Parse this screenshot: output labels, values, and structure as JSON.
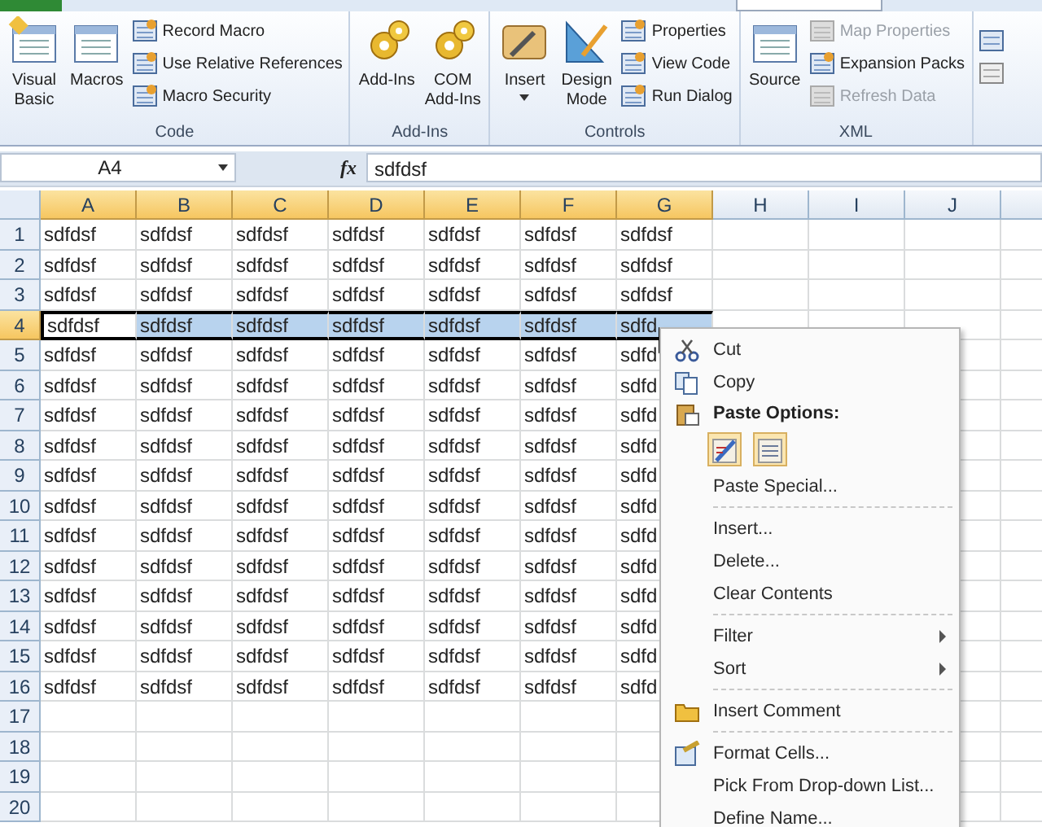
{
  "ribbon": {
    "groups": [
      {
        "label": "Code",
        "large": [
          {
            "lines": [
              "Visual",
              "Basic"
            ]
          },
          {
            "lines": [
              "Macros"
            ]
          }
        ],
        "small": [
          {
            "label": "Record Macro",
            "disabled": false
          },
          {
            "label": "Use Relative References",
            "disabled": false
          },
          {
            "label": "Macro Security",
            "disabled": false
          }
        ]
      },
      {
        "label": "Add-Ins",
        "large": [
          {
            "lines": [
              "Add-Ins"
            ]
          },
          {
            "lines": [
              "COM",
              "Add-Ins"
            ]
          }
        ]
      },
      {
        "label": "Controls",
        "large": [
          {
            "lines": [
              "Insert"
            ],
            "dropdown": true
          },
          {
            "lines": [
              "Design",
              "Mode"
            ]
          }
        ],
        "small": [
          {
            "label": "Properties",
            "disabled": false
          },
          {
            "label": "View Code",
            "disabled": false
          },
          {
            "label": "Run Dialog",
            "disabled": false
          }
        ]
      },
      {
        "label": "XML",
        "large": [
          {
            "lines": [
              "Source"
            ]
          }
        ],
        "small": [
          {
            "label": "Map Properties",
            "disabled": true
          },
          {
            "label": "Expansion Packs",
            "disabled": false
          },
          {
            "label": "Refresh Data",
            "disabled": true
          }
        ]
      }
    ]
  },
  "formula_bar": {
    "name_box": "A4",
    "fx": "fx",
    "value": "sdfdsf"
  },
  "sheet": {
    "columns": [
      {
        "label": "A",
        "selected": true
      },
      {
        "label": "B",
        "selected": true
      },
      {
        "label": "C",
        "selected": true
      },
      {
        "label": "D",
        "selected": true
      },
      {
        "label": "E",
        "selected": true
      },
      {
        "label": "F",
        "selected": true
      },
      {
        "label": "G",
        "selected": true
      },
      {
        "label": "H",
        "selected": false
      },
      {
        "label": "I",
        "selected": false
      },
      {
        "label": "J",
        "selected": false
      }
    ],
    "rows": [
      {
        "number": "1",
        "selected": false,
        "cells": [
          "sdfdsf",
          "sdfdsf",
          "sdfdsf",
          "sdfdsf",
          "sdfdsf",
          "sdfdsf",
          "sdfdsf"
        ]
      },
      {
        "number": "2",
        "selected": false,
        "cells": [
          "sdfdsf",
          "sdfdsf",
          "sdfdsf",
          "sdfdsf",
          "sdfdsf",
          "sdfdsf",
          "sdfdsf"
        ]
      },
      {
        "number": "3",
        "selected": false,
        "cells": [
          "sdfdsf",
          "sdfdsf",
          "sdfdsf",
          "sdfdsf",
          "sdfdsf",
          "sdfdsf",
          "sdfdsf"
        ]
      },
      {
        "number": "4",
        "selected": true,
        "cells": [
          "sdfdsf",
          "sdfdsf",
          "sdfdsf",
          "sdfdsf",
          "sdfdsf",
          "sdfdsf",
          "sdfd"
        ]
      },
      {
        "number": "5",
        "selected": false,
        "cells": [
          "sdfdsf",
          "sdfdsf",
          "sdfdsf",
          "sdfdsf",
          "sdfdsf",
          "sdfdsf",
          "sdfd"
        ]
      },
      {
        "number": "6",
        "selected": false,
        "cells": [
          "sdfdsf",
          "sdfdsf",
          "sdfdsf",
          "sdfdsf",
          "sdfdsf",
          "sdfdsf",
          "sdfd"
        ]
      },
      {
        "number": "7",
        "selected": false,
        "cells": [
          "sdfdsf",
          "sdfdsf",
          "sdfdsf",
          "sdfdsf",
          "sdfdsf",
          "sdfdsf",
          "sdfd"
        ]
      },
      {
        "number": "8",
        "selected": false,
        "cells": [
          "sdfdsf",
          "sdfdsf",
          "sdfdsf",
          "sdfdsf",
          "sdfdsf",
          "sdfdsf",
          "sdfd"
        ]
      },
      {
        "number": "9",
        "selected": false,
        "cells": [
          "sdfdsf",
          "sdfdsf",
          "sdfdsf",
          "sdfdsf",
          "sdfdsf",
          "sdfdsf",
          "sdfd"
        ]
      },
      {
        "number": "10",
        "selected": false,
        "cells": [
          "sdfdsf",
          "sdfdsf",
          "sdfdsf",
          "sdfdsf",
          "sdfdsf",
          "sdfdsf",
          "sdfd"
        ]
      },
      {
        "number": "11",
        "selected": false,
        "cells": [
          "sdfdsf",
          "sdfdsf",
          "sdfdsf",
          "sdfdsf",
          "sdfdsf",
          "sdfdsf",
          "sdfd"
        ]
      },
      {
        "number": "12",
        "selected": false,
        "cells": [
          "sdfdsf",
          "sdfdsf",
          "sdfdsf",
          "sdfdsf",
          "sdfdsf",
          "sdfdsf",
          "sdfd"
        ]
      },
      {
        "number": "13",
        "selected": false,
        "cells": [
          "sdfdsf",
          "sdfdsf",
          "sdfdsf",
          "sdfdsf",
          "sdfdsf",
          "sdfdsf",
          "sdfd"
        ]
      },
      {
        "number": "14",
        "selected": false,
        "cells": [
          "sdfdsf",
          "sdfdsf",
          "sdfdsf",
          "sdfdsf",
          "sdfdsf",
          "sdfdsf",
          "sdfd"
        ]
      },
      {
        "number": "15",
        "selected": false,
        "cells": [
          "sdfdsf",
          "sdfdsf",
          "sdfdsf",
          "sdfdsf",
          "sdfdsf",
          "sdfdsf",
          "sdfd"
        ]
      },
      {
        "number": "16",
        "selected": false,
        "cells": [
          "sdfdsf",
          "sdfdsf",
          "sdfdsf",
          "sdfdsf",
          "sdfdsf",
          "sdfdsf",
          "sdfd"
        ]
      },
      {
        "number": "17",
        "selected": false,
        "cells": []
      },
      {
        "number": "18",
        "selected": false,
        "cells": []
      },
      {
        "number": "19",
        "selected": false,
        "cells": []
      },
      {
        "number": "20",
        "selected": false,
        "cells": []
      }
    ]
  },
  "context_menu": [
    {
      "kind": "item",
      "label": "Cut",
      "submenu": false
    },
    {
      "kind": "item",
      "label": "Copy",
      "submenu": false
    },
    {
      "kind": "header",
      "label": "Paste Options:"
    },
    {
      "kind": "paste_icons"
    },
    {
      "kind": "item",
      "label": "Paste Special...",
      "submenu": false
    },
    {
      "kind": "separator"
    },
    {
      "kind": "item",
      "label": "Insert...",
      "submenu": false
    },
    {
      "kind": "item",
      "label": "Delete...",
      "submenu": false
    },
    {
      "kind": "item",
      "label": "Clear Contents",
      "submenu": false
    },
    {
      "kind": "separator"
    },
    {
      "kind": "item",
      "label": "Filter",
      "submenu": true
    },
    {
      "kind": "item",
      "label": "Sort",
      "submenu": true
    },
    {
      "kind": "separator"
    },
    {
      "kind": "item",
      "label": "Insert Comment",
      "submenu": false
    },
    {
      "kind": "separator"
    },
    {
      "kind": "item",
      "label": "Format Cells...",
      "submenu": false
    },
    {
      "kind": "item",
      "label": "Pick From Drop-down List...",
      "submenu": false
    },
    {
      "kind": "item",
      "label": "Define Name...",
      "submenu": false
    }
  ]
}
